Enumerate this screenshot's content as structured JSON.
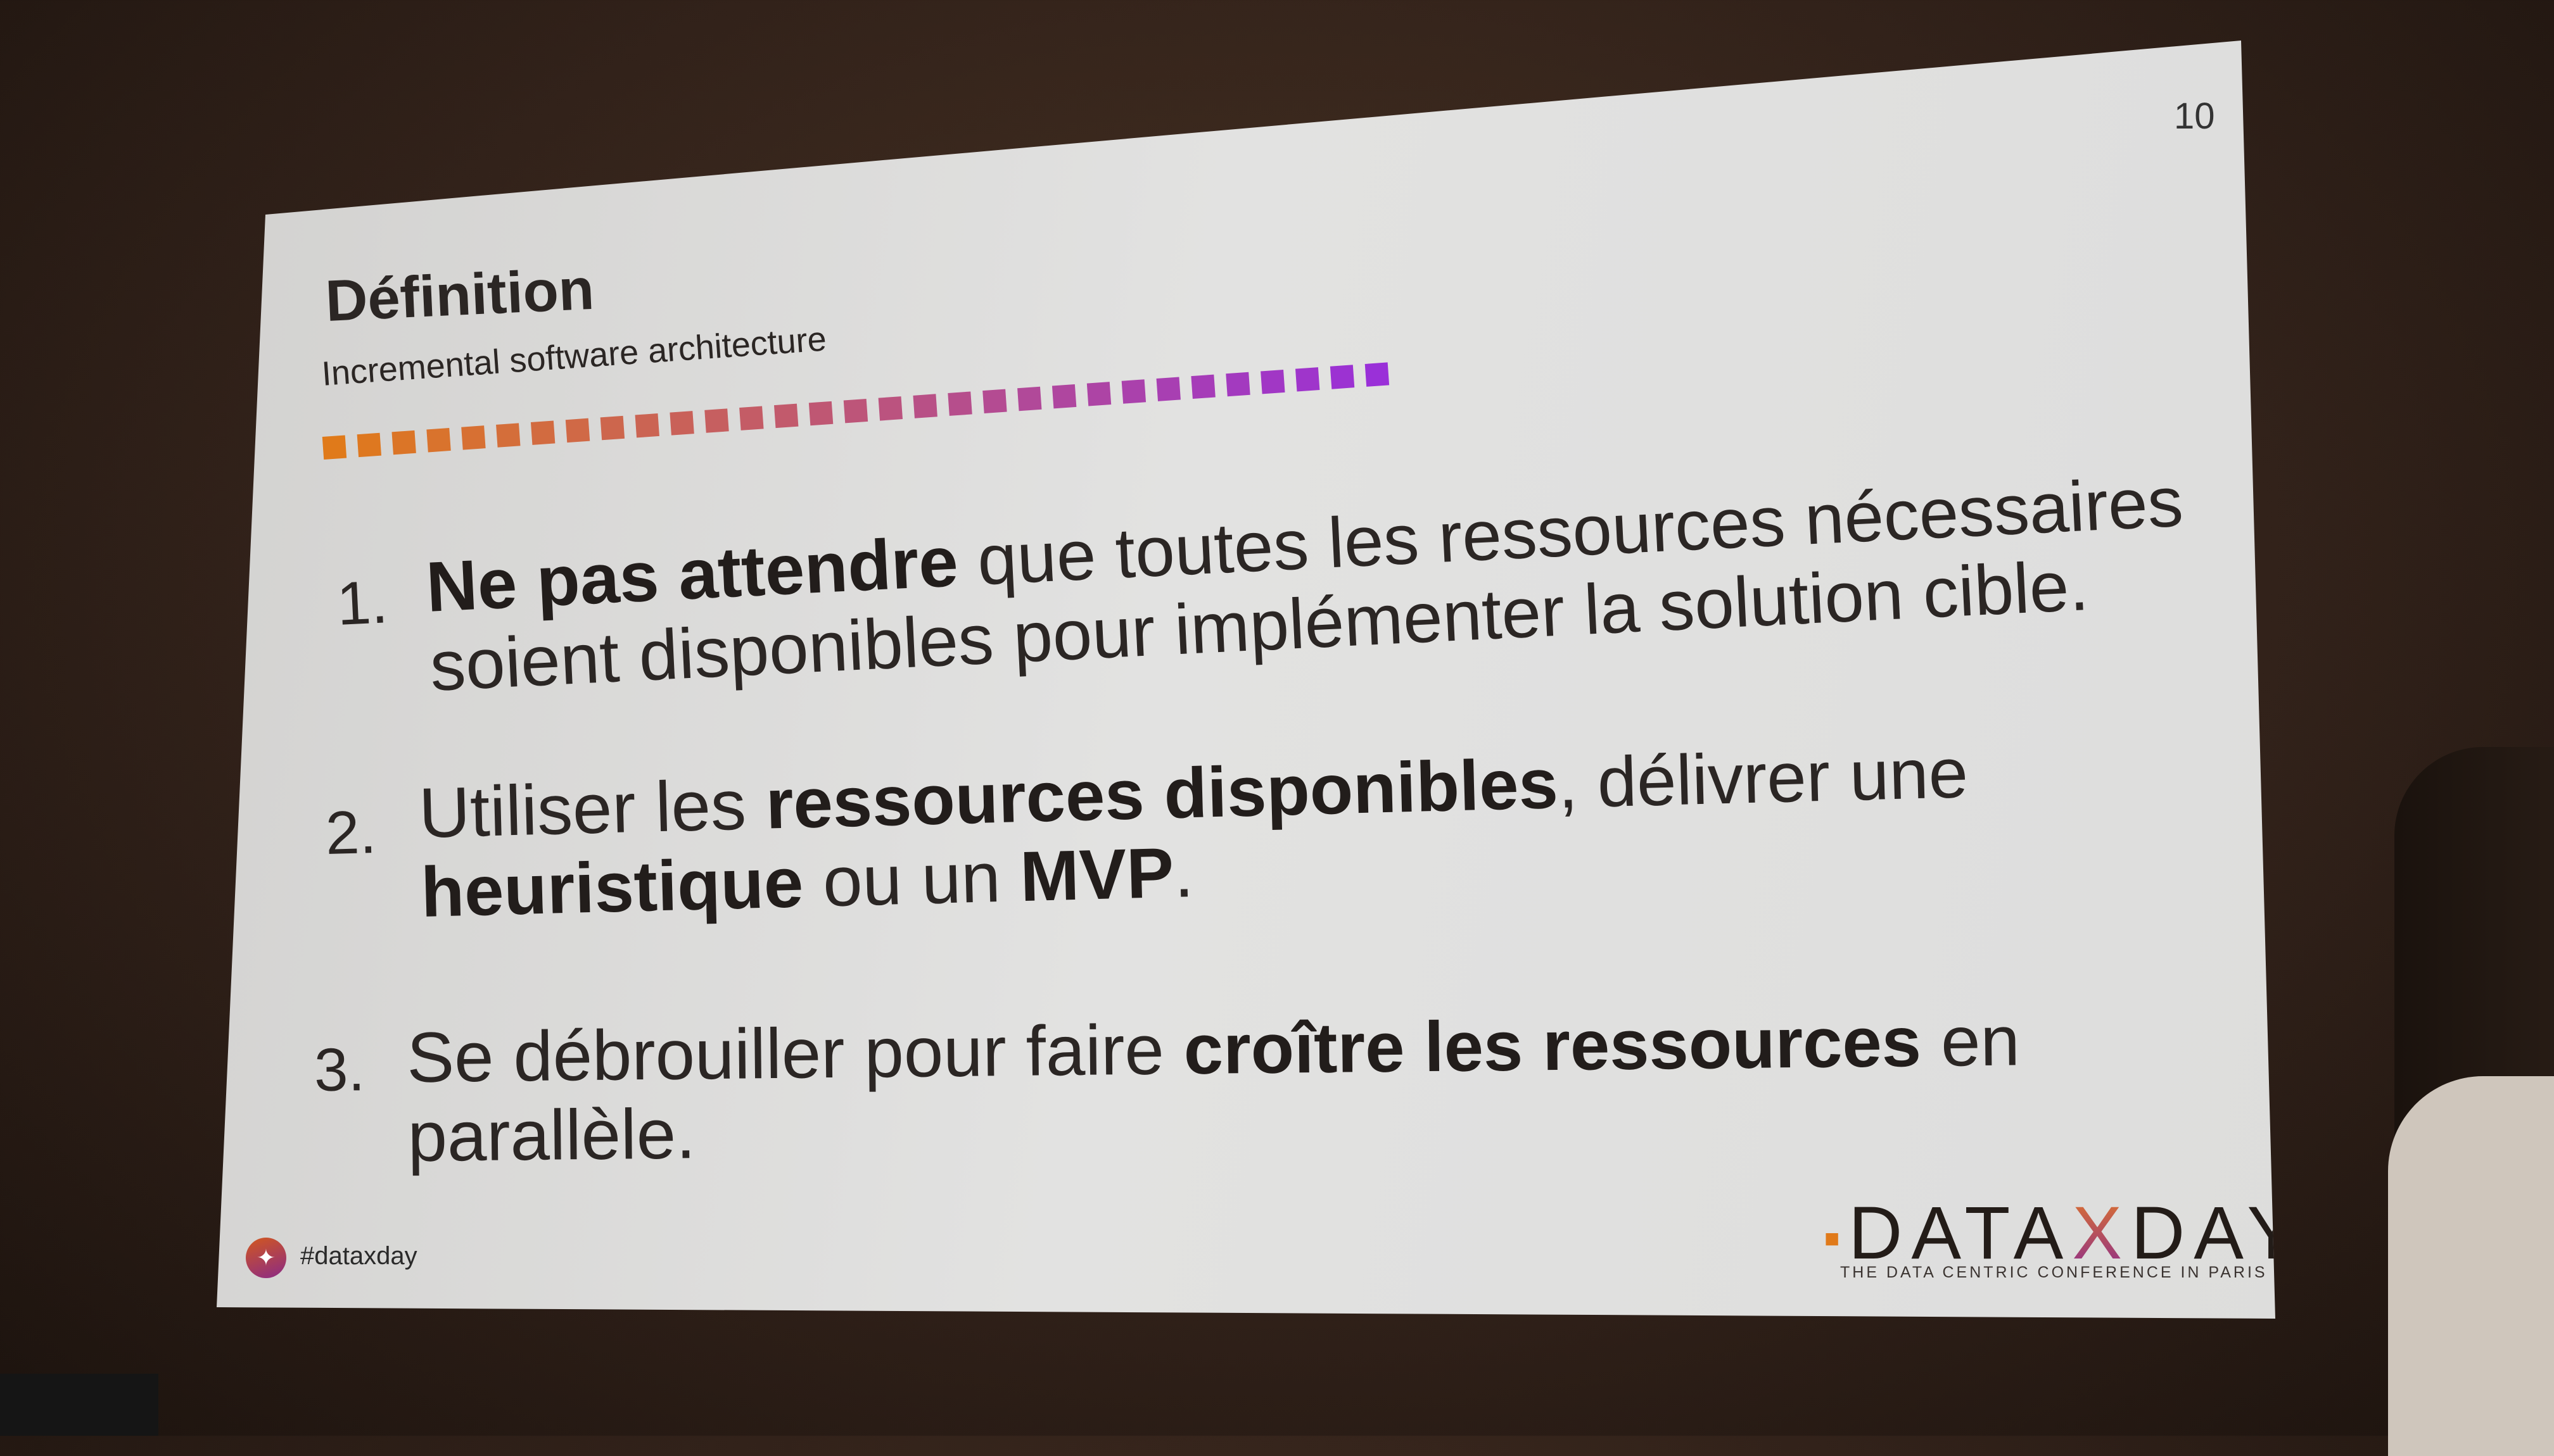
{
  "slide": {
    "page_number": "10",
    "title": "Définition",
    "subtitle": "Incremental software architecture",
    "progress_colors": {
      "start": "#e07a1a",
      "end": "#9a30d8"
    },
    "items": [
      {
        "number": "1.",
        "line1": [
          {
            "text": "Ne pas attendre",
            "bold": true
          },
          {
            "text": " que toutes les ressources nécessaires",
            "bold": false
          }
        ],
        "line2": [
          {
            "text": "soient disponibles pour implémenter la solution cible.",
            "bold": false
          }
        ]
      },
      {
        "number": "2.",
        "line1": [
          {
            "text": "Utiliser les ",
            "bold": false
          },
          {
            "text": "ressources disponibles",
            "bold": true
          },
          {
            "text": ", délivrer une",
            "bold": false
          }
        ],
        "line2": [
          {
            "text": "heuristique",
            "bold": true
          },
          {
            "text": " ou un ",
            "bold": false
          },
          {
            "text": "MVP",
            "bold": true
          },
          {
            "text": ".",
            "bold": false
          }
        ]
      },
      {
        "number": "3.",
        "line1": [
          {
            "text": "Se débrouiller pour faire ",
            "bold": false
          },
          {
            "text": "croître les ressources",
            "bold": true
          },
          {
            "text": " en",
            "bold": false
          }
        ],
        "line2": [
          {
            "text": "parallèle.",
            "bold": false
          }
        ]
      }
    ],
    "footer": {
      "twitter_icon": "twitter-bird-icon",
      "hashtag": "#dataxday",
      "logo_pre": "DATA",
      "logo_x": "X",
      "logo_post": "DAY",
      "tagline": "THE DATA CENTRIC CONFERENCE IN PARIS"
    }
  }
}
